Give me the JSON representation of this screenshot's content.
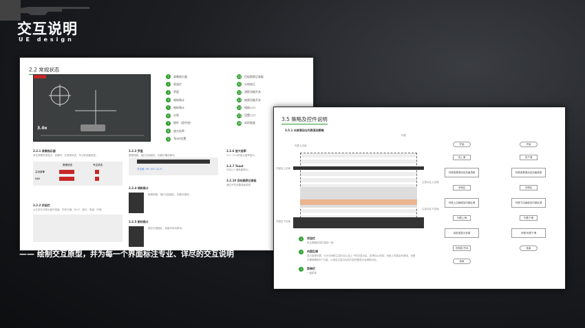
{
  "header": {
    "title": "交互说明",
    "subtitle": "UE design"
  },
  "caption": "—— 绘制交互原型，并为每一个界面标注专业、详尽的交互说明",
  "page1": {
    "title": "2.2 常规状态",
    "game_zoom": "3.0x",
    "legend": [
      "录像指示器",
      "状态栏",
      "罗盘",
      "倾斜角计",
      "俯仰角计",
      "分划",
      "摇杆（居中态）",
      "放大倍率",
      "Toast位置",
      "目标图表记录板",
      "分划修正",
      "测距功能开关",
      "夜视功能开关",
      "相册入口",
      "设置入口",
      "实时画面"
    ],
    "sections": [
      {
        "h": "2.2.1 录像指示器",
        "t": "未在录像时常显示，录像时，在常规状态、专注状态都常显。"
      },
      {
        "h": "2.2.2 状态栏",
        "t": "从左至右分别为蓝牙连接、内存已满、Wi-Fi、蓝牙、电量、时间。"
      },
      {
        "h": "2.2.3 罗盘",
        "t": "图视相随，指针位相固定，刻度可横向移动。"
      },
      {
        "h": "2.2.4 倾斜角计",
        "t": "图视相随，指针位相固定，刻度可旋转。"
      },
      {
        "h": "2.2.5 俯仰角计",
        "t": "指针位相固定，刻度可纵向移动。"
      },
      {
        "h": "2.2.6 放大倍率",
        "t": "3.0~12.0的放大倍率显示。"
      },
      {
        "h": "2.2.7 Toast",
        "t": "详见2.0 清晰度提示。"
      },
      {
        "h": "2.2.10 目标图表记录板",
        "t": "通过不在设置或者说明"
      }
    ],
    "table": {
      "headers": [
        "常规状态",
        "专注状态"
      ],
      "rows": [
        "主动录像",
        "NAV"
      ]
    },
    "compass_readout": "方位角: 90°-45°-22.5°"
  },
  "page2": {
    "title": "3.5 策略及控件说明",
    "subtitle": "3.5.1 长按滑动与列表滚动策略",
    "diagram_labels": [
      "列表上边缘",
      "列表",
      "内部区上边缘",
      "内部区下边缘",
      "主显示区上边缘",
      "主显示区下边缘"
    ],
    "flow1": [
      "开始",
      "向上滑",
      "列表或是滚动至页面顶部",
      "无响应",
      "列表上边缘碰至内部区域",
      "列表上滑",
      "向前或显示多端",
      "无响应/不动",
      "结束"
    ],
    "flow2": [
      "开始",
      "向下滑",
      "列表或是滚动至页面底部",
      "无响应",
      "列表下边缘碰至内部区域",
      "列表下滑",
      "列表/列表下滑",
      "结束"
    ],
    "notes": [
      {
        "n": "1",
        "h": "状态栏",
        "t": "和主屏幕状态栏保持一致"
      },
      {
        "n": "2",
        "h": "内容区域",
        "t": "显示菜单列表，分为中间的主显示区以及上下的次显示区。将滑动以完成，页面上可能会有遮挡，但是无需精确到N个分量，以保证主显示区的内容完整显示及清晰可见。"
      },
      {
        "n": "3",
        "h": "菜单栏",
        "t": "一级菜单"
      }
    ]
  }
}
